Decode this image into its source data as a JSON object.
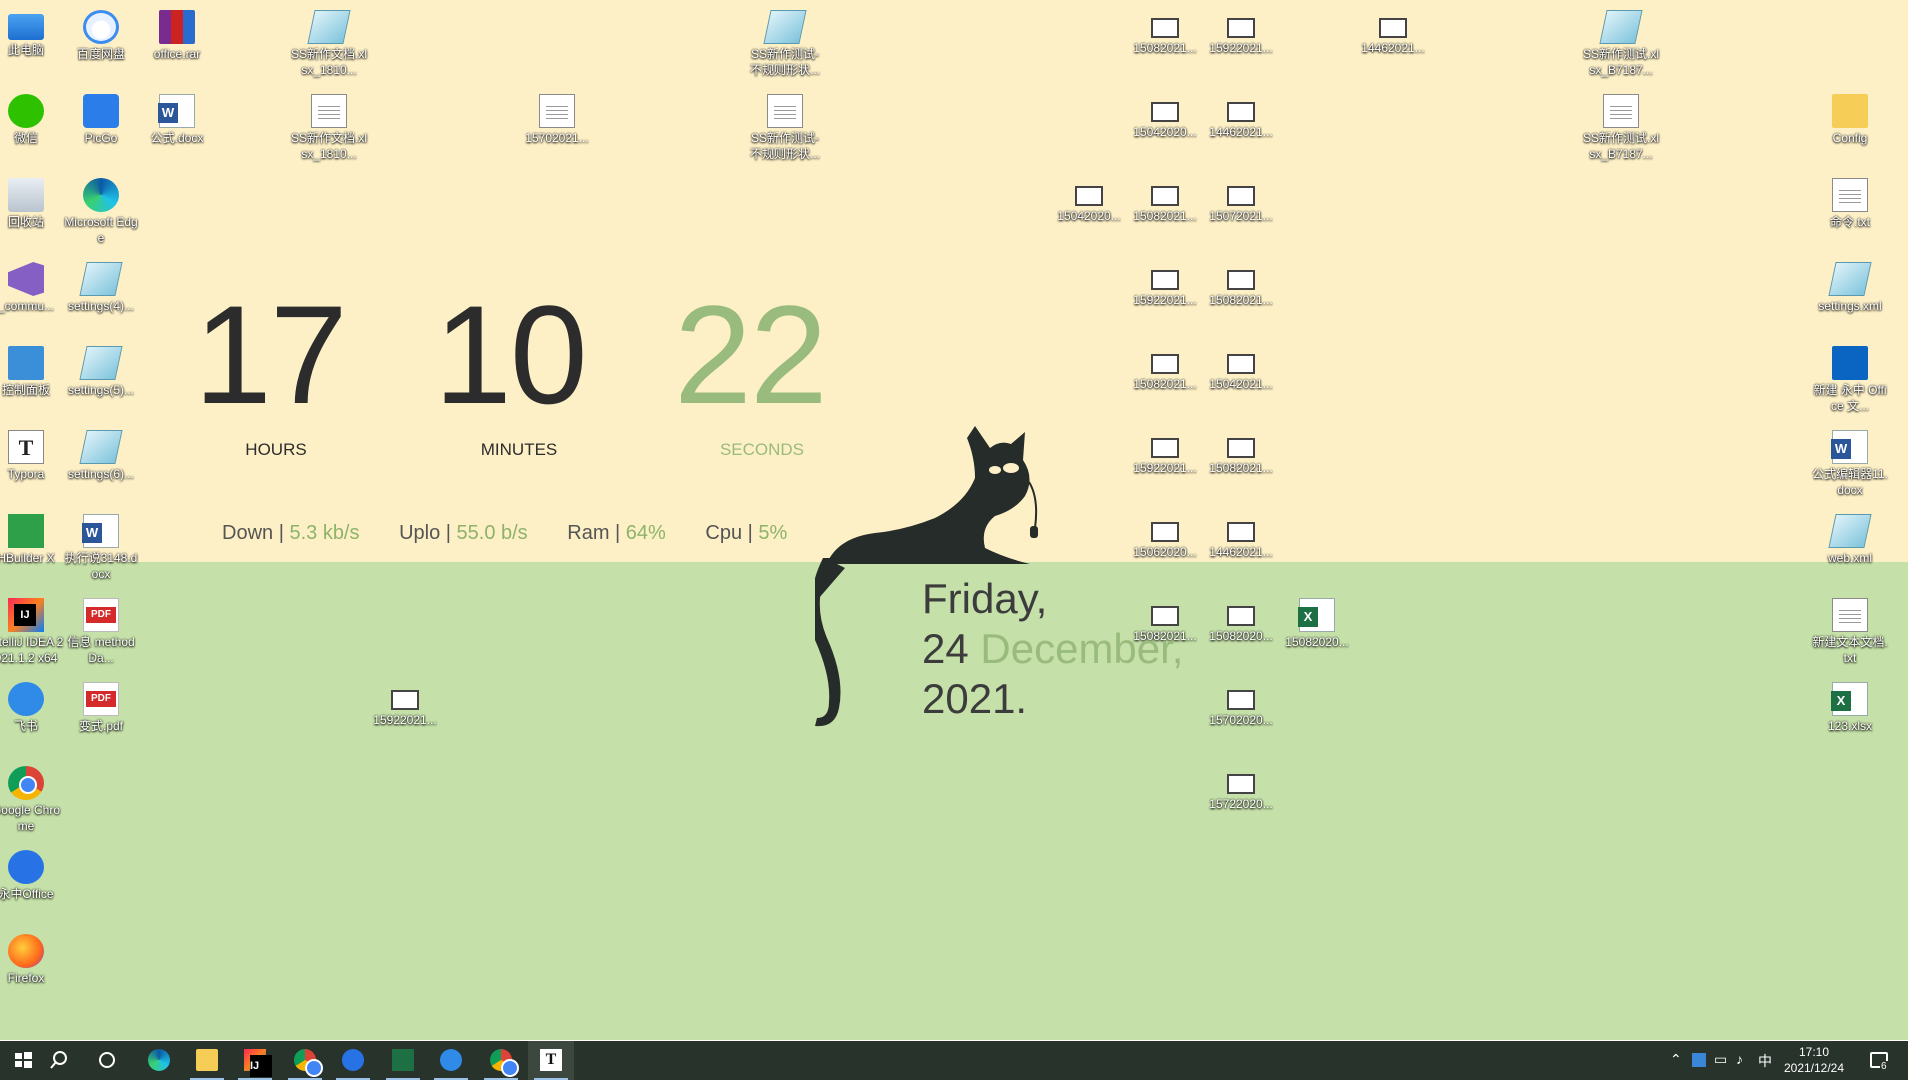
{
  "desktop": {
    "icons": [
      {
        "label": "此电脑",
        "icon": "computer-icon"
      },
      {
        "label": "百度网盘",
        "icon": "cloud-drive-icon"
      },
      {
        "label": "office.rar",
        "icon": "archive-icon"
      },
      {
        "label": "SS新作文档.xlsx_1810...",
        "icon": "ini-file-icon"
      },
      {
        "label": "SS新作测试-不规则形状...",
        "icon": "ini-file-icon"
      },
      {
        "label": "15082021...",
        "icon": "video-file-icon"
      },
      {
        "label": "15922021...",
        "icon": "video-file-icon"
      },
      {
        "label": "14462021...",
        "icon": "video-file-icon"
      },
      {
        "label": "SS新作测试.xlsx_B7187...",
        "icon": "ini-file-icon"
      },
      {
        "label": "微信",
        "icon": "wechat-icon"
      },
      {
        "label": "PicGo",
        "icon": "picgo-icon"
      },
      {
        "label": "公式.docx",
        "icon": "word-file-icon"
      },
      {
        "label": "SS新作文档.xlsx_1810...",
        "icon": "text-file-icon"
      },
      {
        "label": "15702021...",
        "icon": "text-file-icon"
      },
      {
        "label": "SS新作测试-不规则形状...",
        "icon": "text-file-icon"
      },
      {
        "label": "15042020...",
        "icon": "video-file-icon"
      },
      {
        "label": "14462021...",
        "icon": "video-file-icon"
      },
      {
        "label": "SS新作测试.xlsx_B7187...",
        "icon": "text-file-icon"
      },
      {
        "label": "Config",
        "icon": "folder-icon"
      },
      {
        "label": "回收站",
        "icon": "recycle-bin-icon"
      },
      {
        "label": "Microsoft Edge",
        "icon": "edge-icon"
      },
      {
        "label": "15042020...",
        "icon": "video-file-icon"
      },
      {
        "label": "15082021...",
        "icon": "video-file-icon"
      },
      {
        "label": "15072021...",
        "icon": "video-file-icon"
      },
      {
        "label": "命令.txt",
        "icon": "text-file-icon"
      },
      {
        "label": "_commu...",
        "icon": "visual-studio-icon"
      },
      {
        "label": "settings(4)...",
        "icon": "ini-file-icon"
      },
      {
        "label": "15922021...",
        "icon": "video-file-icon"
      },
      {
        "label": "15082021...",
        "icon": "video-file-icon"
      },
      {
        "label": "settings.xml",
        "icon": "ini-file-icon"
      },
      {
        "label": "控制面板",
        "icon": "control-panel-icon"
      },
      {
        "label": "settings(5)...",
        "icon": "ini-file-icon"
      },
      {
        "label": "15082021...",
        "icon": "video-file-icon"
      },
      {
        "label": "15042021...",
        "icon": "video-file-icon"
      },
      {
        "label": "新建 永中 Office 文...",
        "icon": "outlook-file-icon"
      },
      {
        "label": "Typora",
        "icon": "typora-icon"
      },
      {
        "label": "settings(6)...",
        "icon": "ini-file-icon"
      },
      {
        "label": "15922021...",
        "icon": "video-file-icon"
      },
      {
        "label": "15082021...",
        "icon": "video-file-icon"
      },
      {
        "label": "公式编辑器11.docx",
        "icon": "word-file-icon"
      },
      {
        "label": "HBuilder X",
        "icon": "hbuilder-icon"
      },
      {
        "label": "执行说3148.docx",
        "icon": "word-file-icon"
      },
      {
        "label": "15062020...",
        "icon": "video-file-icon"
      },
      {
        "label": "14462021...",
        "icon": "video-file-icon"
      },
      {
        "label": "web.xml",
        "icon": "ini-file-icon"
      },
      {
        "label": "IntelliJ IDEA 2021.1.2 x64",
        "icon": "intellij-icon"
      },
      {
        "label": "信息 methodDa...",
        "icon": "pdf-file-icon"
      },
      {
        "label": "15082021...",
        "icon": "video-file-icon"
      },
      {
        "label": "15082020...",
        "icon": "video-file-icon"
      },
      {
        "label": "15082020...",
        "icon": "excel-file-icon"
      },
      {
        "label": "新建文本文档.txt",
        "icon": "text-file-icon"
      },
      {
        "label": "飞书",
        "icon": "feishu-icon"
      },
      {
        "label": "变式.pdf",
        "icon": "pdf-file-icon"
      },
      {
        "label": "15922021...",
        "icon": "video-file-icon"
      },
      {
        "label": "15702020...",
        "icon": "video-file-icon"
      },
      {
        "label": "123.xlsx",
        "icon": "excel-file-icon"
      },
      {
        "label": "Google Chrome",
        "icon": "chrome-icon"
      },
      {
        "label": "15722020...",
        "icon": "video-file-icon"
      },
      {
        "label": "永中Office",
        "icon": "wps-icon"
      },
      {
        "label": "Firefox",
        "icon": "firefox-icon"
      }
    ]
  },
  "clock": {
    "hours": "17",
    "minutes": "10",
    "seconds": "22",
    "hours_label": "HOURS",
    "minutes_label": "MINUTES",
    "seconds_label": "SECONDS"
  },
  "stats": {
    "down_label": "Down |",
    "down_value": "5.3 kb/s",
    "up_label": "Uplo |",
    "up_value": "55.0 b/s",
    "ram_label": "Ram |",
    "ram_value": "64%",
    "cpu_label": "Cpu |",
    "cpu_value": "5%"
  },
  "date": {
    "weekday": "Friday,",
    "day": "24",
    "month": "December,",
    "year": "2021."
  },
  "taskbar": {
    "apps": [
      "start-icon",
      "search-icon",
      "cortana-icon",
      "edge-icon",
      "file-explorer-icon",
      "intellij-icon",
      "chrome-icon",
      "wps-icon",
      "excel-icon",
      "feishu-icon",
      "chrome-icon",
      "typora-icon"
    ],
    "tray": {
      "ime": "中",
      "time": "17:10",
      "date": "2021/12/24",
      "notifications": "6"
    }
  },
  "colors": {
    "wall_top": "#fdf0c6",
    "wall_bottom": "#c5e0a8",
    "accent_green": "#8db36a",
    "taskbar": "#27332b"
  }
}
